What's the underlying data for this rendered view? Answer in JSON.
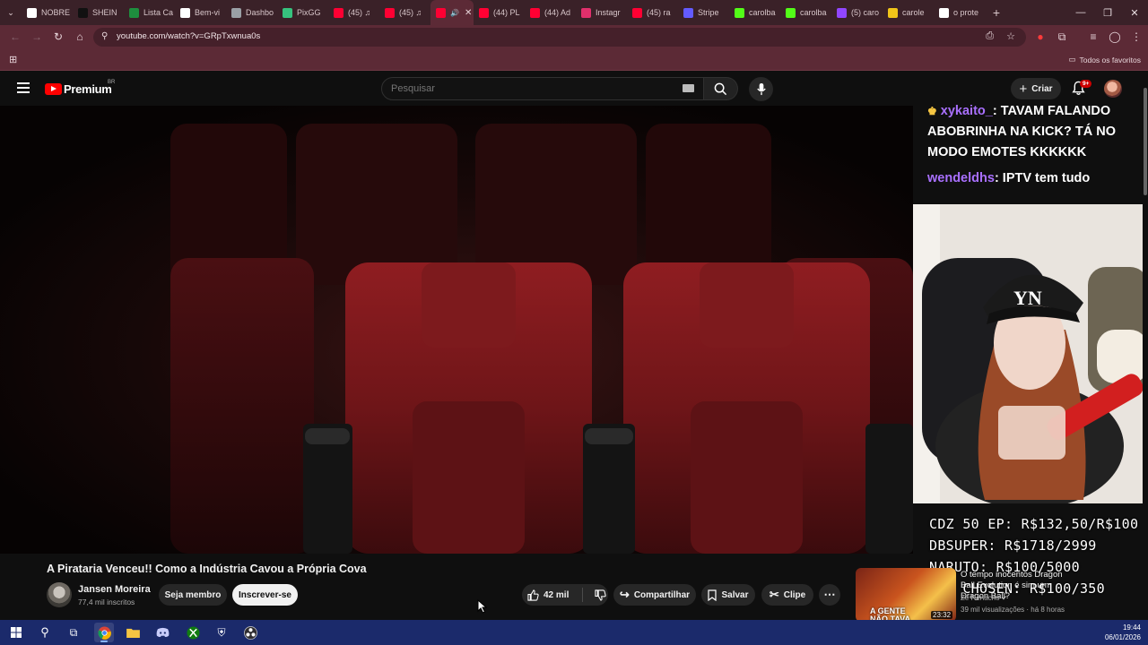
{
  "browser": {
    "tabs": [
      {
        "label": "NOBRE",
        "color": "#ffffff",
        "icon": "amazon-icon"
      },
      {
        "label": "SHEIN",
        "color": "#111111",
        "icon": "shein-icon"
      },
      {
        "label": "Lista Ca",
        "color": "#1e8e3e",
        "icon": "sheets-icon"
      },
      {
        "label": "Bem-vi",
        "color": "#ffffff",
        "icon": "notion-icon"
      },
      {
        "label": "Dashbo",
        "color": "#9aa0a6",
        "icon": "globe-icon"
      },
      {
        "label": "PixGG",
        "color": "#36c27e",
        "icon": "pixgg-icon"
      },
      {
        "label": "(45) ♫",
        "color": "#ff0033",
        "icon": "youtube-icon"
      },
      {
        "label": "(45) ♫",
        "color": "#ff0033",
        "icon": "youtube-icon"
      },
      {
        "label": "",
        "color": "#ff0033",
        "icon": "youtube-icon",
        "active": true
      },
      {
        "label": "(44) PL",
        "color": "#ff0033",
        "icon": "youtube-icon"
      },
      {
        "label": "(44) Ad",
        "color": "#ff0033",
        "icon": "youtube-icon"
      },
      {
        "label": "Instagr",
        "color": "#e1306c",
        "icon": "instagram-icon"
      },
      {
        "label": "(45) ra",
        "color": "#ff0033",
        "icon": "youtube-icon"
      },
      {
        "label": "Stripe",
        "color": "#635bff",
        "icon": "stripe-icon"
      },
      {
        "label": "carolba",
        "color": "#53fc18",
        "icon": "kick-icon"
      },
      {
        "label": "carolba",
        "color": "#53fc18",
        "icon": "kick-icon"
      },
      {
        "label": "(5) caro",
        "color": "#9146ff",
        "icon": "twitch-icon"
      },
      {
        "label": "carole",
        "color": "#f0c419",
        "icon": "streamelements-icon"
      },
      {
        "label": "o prote",
        "color": "#ffffff",
        "icon": "google-icon"
      }
    ],
    "url": "youtube.com/watch?v=GRpTxwnua0s",
    "bookmarks_all": "Todos os favoritos"
  },
  "youtube": {
    "logo_text": "Premium",
    "logo_region": "BR",
    "search_placeholder": "Pesquisar",
    "create_label": "Criar",
    "notif_badge": "9+"
  },
  "chat": [
    {
      "user": "xykaito_",
      "message": ": TAVAM FALANDO ABOBRINHA NA KICK? TÁ NO MODO EMOTES KKKKKK",
      "user_color": "#a970ff"
    },
    {
      "user": "wendeldhs",
      "message": ": IPTV tem tudo",
      "user_color": "#a970ff"
    }
  ],
  "price_overlay": [
    "CDZ 50 EP: R$132,50/R$100",
    "DBSUPER: R$1718/2999",
    "NARUTO: R$100/5000",
    "THE CHOSEN: R$100/350"
  ],
  "video": {
    "title": "A Pirataria Venceu!! Como a Indústria Cavou a Própria Cova",
    "channel": "Jansen Moreira",
    "subscribers": "77,4 mil inscritos",
    "member_label": "Seja membro",
    "subscribe_label": "Inscrever-se",
    "likes": "42 mil",
    "share_label": "Compartilhar",
    "save_label": "Salvar",
    "clip_label": "Clipe"
  },
  "recommendation": {
    "title": "O tempo inocentos Dragon Ball Evolution é sim um Dragon Ball?",
    "channel": "Zé Renacho",
    "meta": "39 mil visualizações · há 8 horas",
    "duration": "23:32",
    "thumb_text": "A GENTE NÃO TAVA PRONT"
  },
  "taskbar": {
    "time": "19:44",
    "date": "06/01/2026"
  }
}
